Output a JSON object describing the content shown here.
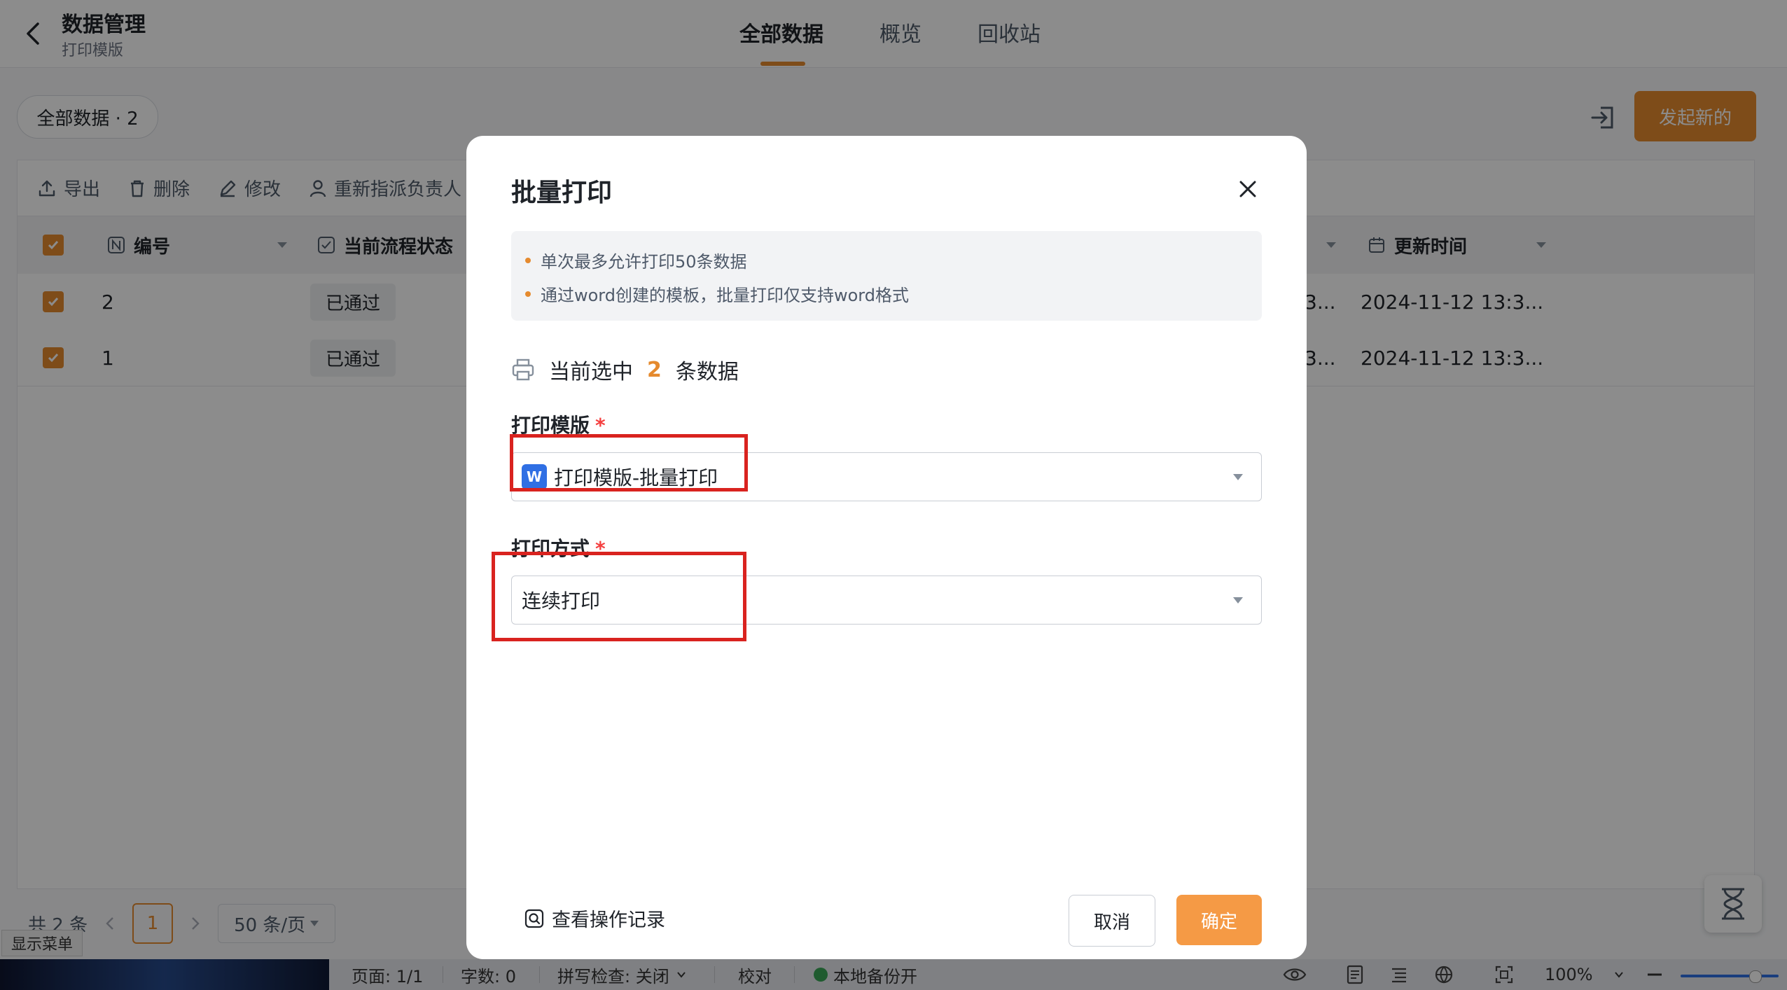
{
  "header": {
    "title": "数据管理",
    "subtitle": "打印模版",
    "tabs": [
      {
        "label": "全部数据",
        "active": true
      },
      {
        "label": "概览",
        "active": false
      },
      {
        "label": "回收站",
        "active": false
      }
    ]
  },
  "filter": {
    "chip_label": "全部数据 · 2"
  },
  "actions": {
    "start_label": "发起新的"
  },
  "toolbar": {
    "export": "导出",
    "delete": "删除",
    "edit": "修改",
    "reassign": "重新指派负责人"
  },
  "table": {
    "columns": {
      "id": "编号",
      "status": "当前流程状态",
      "updated": "更新时间"
    },
    "rows": [
      {
        "id": "2",
        "status": "已通过",
        "partial": "3...",
        "updated": "2024-11-12 13:3..."
      },
      {
        "id": "1",
        "status": "已通过",
        "partial": "3...",
        "updated": "2024-11-12 13:3..."
      }
    ]
  },
  "pagination": {
    "total_text": "共 2 条",
    "current_page": "1",
    "page_size": "50 条/页"
  },
  "float_menu_chip": "显示菜单",
  "statusbar": {
    "page": "页面: 1/1",
    "words": "字数: 0",
    "spellcheck": "拼写检查: 关闭",
    "proofread": "校对",
    "backup": "本地备份开",
    "zoom": "100%"
  },
  "modal": {
    "title": "批量打印",
    "notices": [
      "单次最多允许打印50条数据",
      "通过word创建的模板，批量打印仅支持word格式"
    ],
    "selected_prefix": "当前选中",
    "selected_count": "2",
    "selected_suffix": "条数据",
    "template_label": "打印模版",
    "template_value": "打印模版-批量打印",
    "template_icon_text": "W",
    "method_label": "打印方式",
    "method_value": "连续打印",
    "required_mark": "*",
    "log_link": "查看操作记录",
    "cancel": "取消",
    "confirm": "确定"
  },
  "colors": {
    "accent": "#e58a2e",
    "highlight": "#d9231f",
    "required": "#f53f3f"
  }
}
